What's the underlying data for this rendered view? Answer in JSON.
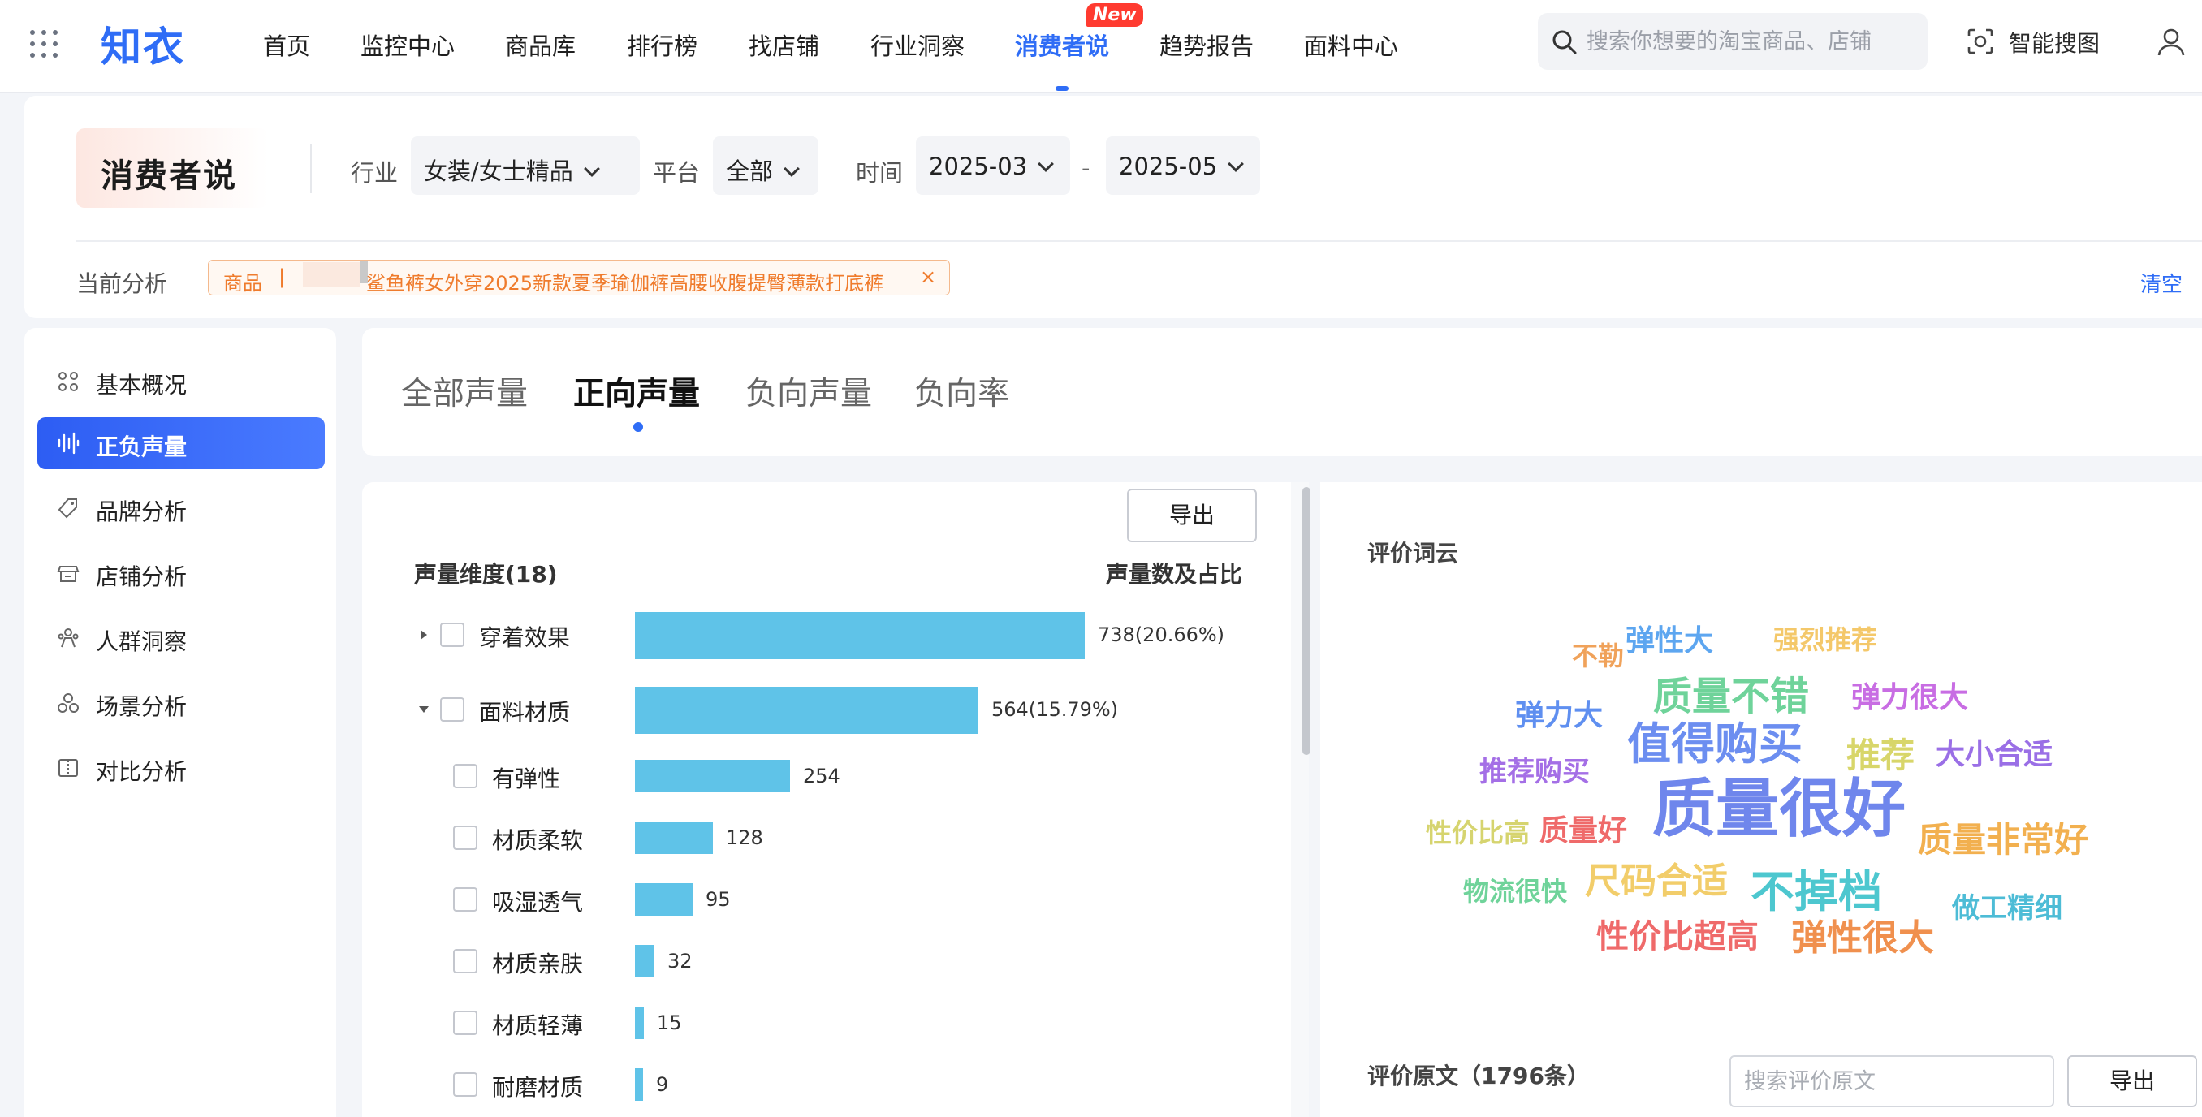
{
  "header": {
    "logo": "知衣",
    "nav": [
      "首页",
      "监控中心",
      "商品库",
      "排行榜",
      "找店铺",
      "行业洞察",
      "消费者说",
      "趋势报告",
      "面料中心"
    ],
    "active_nav": "消费者说",
    "new_badge": "New",
    "search_placeholder": "搜索你想要的淘宝商品、店铺",
    "image_search_label": "智能搜图",
    "icons": [
      "apps-grid-icon",
      "search-icon",
      "camera-scan-icon",
      "user-icon"
    ]
  },
  "filters": {
    "page_title": "消费者说",
    "industry_label": "行业",
    "industry_value": "女装/女士精品",
    "platform_label": "平台",
    "platform_value": "全部",
    "time_label": "时间",
    "time_start": "2025-03",
    "time_sep": "-",
    "time_end": "2025-05",
    "current_label": "当前分析",
    "tag_category": "商品",
    "tag_separator": "|",
    "tag_name": "鲨鱼裤女外穿2025新款夏季瑜伽裤高腰收腹提臀薄款打底裤",
    "tag_close": "×",
    "clear_label": "清空"
  },
  "sidebar": {
    "items": [
      {
        "label": "基本概况",
        "icon": "dots-grid-icon"
      },
      {
        "label": "正负声量",
        "icon": "sound-wave-icon"
      },
      {
        "label": "品牌分析",
        "icon": "tag-icon"
      },
      {
        "label": "店铺分析",
        "icon": "store-icon"
      },
      {
        "label": "人群洞察",
        "icon": "people-icon"
      },
      {
        "label": "场景分析",
        "icon": "scene-icon"
      },
      {
        "label": "对比分析",
        "icon": "compare-icon"
      }
    ],
    "active": "正负声量"
  },
  "tabs": {
    "items": [
      "全部声量",
      "正向声量",
      "负向声量",
      "负向率"
    ],
    "active": "正向声量"
  },
  "volume": {
    "export_label": "导出",
    "dim_header": "声量维度(18)",
    "value_header": "声量数及占比",
    "rows": [
      {
        "label": "穿着效果",
        "value": 738,
        "display": "738(20.66%)",
        "level": 0,
        "expanded": false
      },
      {
        "label": "面料材质",
        "value": 564,
        "display": "564(15.79%)",
        "level": 0,
        "expanded": true
      },
      {
        "label": "有弹性",
        "value": 254,
        "display": "254",
        "level": 1
      },
      {
        "label": "材质柔软",
        "value": 128,
        "display": "128",
        "level": 1
      },
      {
        "label": "吸湿透气",
        "value": 95,
        "display": "95",
        "level": 1
      },
      {
        "label": "材质亲肤",
        "value": 32,
        "display": "32",
        "level": 1
      },
      {
        "label": "材质轻薄",
        "value": 15,
        "display": "15",
        "level": 1
      },
      {
        "label": "耐磨材质",
        "value": 9,
        "display": "9",
        "level": 1
      }
    ],
    "bar_color": "#5fc3e8"
  },
  "wordcloud": {
    "title": "评价词云",
    "words": [
      {
        "text": "质量很好",
        "color": "#6f86ec"
      },
      {
        "text": "值得购买",
        "color": "#6c8ef0"
      },
      {
        "text": "质量不错",
        "color": "#6fd39a"
      },
      {
        "text": "不掉档",
        "color": "#4dc7cf"
      },
      {
        "text": "尺码合适",
        "color": "#f2cd6a"
      },
      {
        "text": "质量非常好",
        "color": "#f2b04f"
      },
      {
        "text": "弹性很大",
        "color": "#f0904e"
      },
      {
        "text": "性价比超高",
        "color": "#ef6a6a"
      },
      {
        "text": "弹力很大",
        "color": "#c86de3"
      },
      {
        "text": "推荐",
        "color": "#d8d66a"
      },
      {
        "text": "大小合适",
        "color": "#9a6fe6"
      },
      {
        "text": "推荐购买",
        "color": "#a46fe6"
      },
      {
        "text": "质量好",
        "color": "#ef6a6a"
      },
      {
        "text": "弹力大",
        "color": "#5f8ff0"
      },
      {
        "text": "弹性大",
        "color": "#5da6f0"
      },
      {
        "text": "强烈推荐",
        "color": "#f4c86a"
      },
      {
        "text": "不勒",
        "color": "#f0a25a"
      },
      {
        "text": "性价比高",
        "color": "#d6d46f"
      },
      {
        "text": "物流很快",
        "color": "#6fd39a"
      },
      {
        "text": "做工精细",
        "color": "#4dbcd6"
      }
    ],
    "reviews_title": "评价原文（1796条）",
    "reviews_search_placeholder": "搜索评价原文",
    "export_label": "导出"
  }
}
